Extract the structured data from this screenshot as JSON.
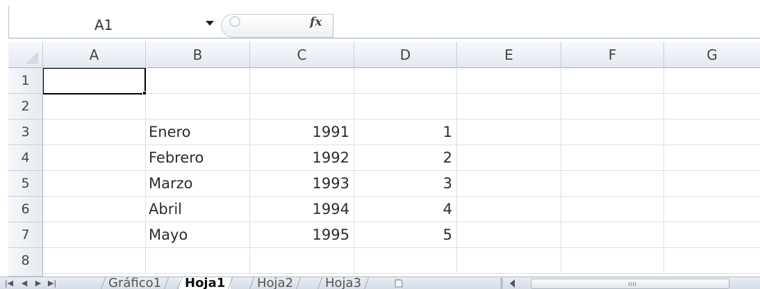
{
  "formula_bar": {
    "name_box": "A1",
    "fx_label": "fx",
    "formula_value": ""
  },
  "columns": [
    "A",
    "B",
    "C",
    "D",
    "E",
    "F",
    "G"
  ],
  "rows": [
    {
      "num": "1",
      "cells": [
        "",
        "",
        "",
        "",
        "",
        "",
        ""
      ]
    },
    {
      "num": "2",
      "cells": [
        "",
        "",
        "",
        "",
        "",
        "",
        ""
      ]
    },
    {
      "num": "3",
      "cells": [
        "",
        "Enero",
        "1991",
        "1",
        "",
        "",
        ""
      ]
    },
    {
      "num": "4",
      "cells": [
        "",
        "Febrero",
        "1992",
        "2",
        "",
        "",
        ""
      ]
    },
    {
      "num": "5",
      "cells": [
        "",
        "Marzo",
        "1993",
        "3",
        "",
        "",
        ""
      ]
    },
    {
      "num": "6",
      "cells": [
        "",
        "Abril",
        "1994",
        "4",
        "",
        "",
        ""
      ]
    },
    {
      "num": "7",
      "cells": [
        "",
        "Mayo",
        "1995",
        "5",
        "",
        "",
        ""
      ]
    },
    {
      "num": "8",
      "cells": [
        "",
        "",
        "",
        "",
        "",
        "",
        ""
      ]
    }
  ],
  "active_cell": "A1",
  "sheet_tabs": [
    {
      "label": "Gráfico1",
      "active": false
    },
    {
      "label": "Hoja1",
      "active": true
    },
    {
      "label": "Hoja2",
      "active": false
    },
    {
      "label": "Hoja3",
      "active": false
    }
  ],
  "icons": {
    "nav_first": "first-sheet-icon",
    "nav_prev": "prev-sheet-icon",
    "nav_next": "next-sheet-icon",
    "nav_last": "last-sheet-icon",
    "new_sheet": "new-sheet-icon"
  },
  "colors": {
    "header_gradient_top": "#f7f9fc",
    "header_gradient_bottom": "#e4e9f0",
    "gridline": "#dadfe6",
    "active_border": "#000000"
  }
}
